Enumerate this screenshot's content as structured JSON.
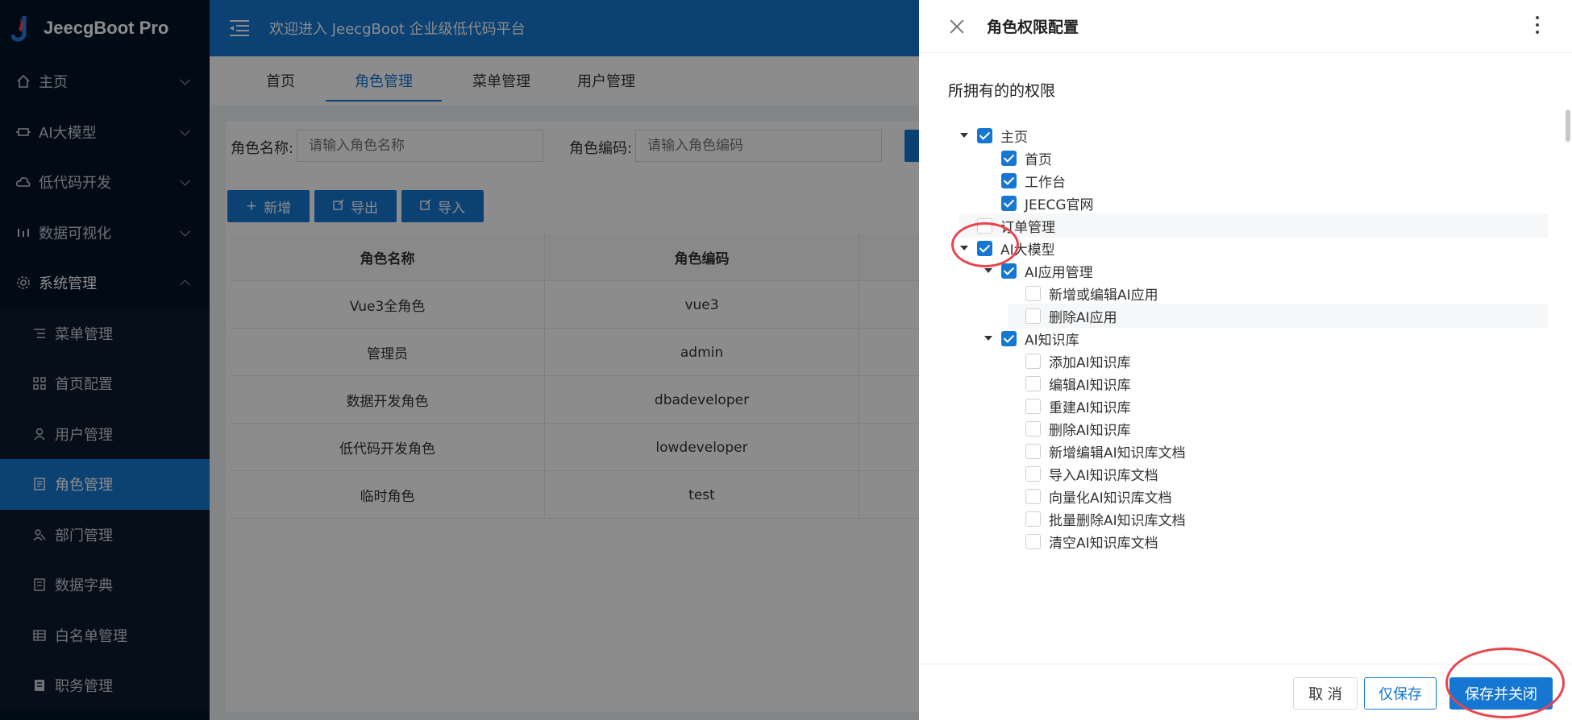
{
  "app": {
    "name": "JeecgBoot Pro"
  },
  "sidebar": {
    "items": [
      {
        "label": "主页",
        "icon": "home-icon"
      },
      {
        "label": "AI大模型",
        "icon": "ai-icon"
      },
      {
        "label": "低代码开发",
        "icon": "cloud-icon"
      },
      {
        "label": "数据可视化",
        "icon": "chart-icon"
      },
      {
        "label": "系统管理",
        "icon": "gear-icon"
      }
    ],
    "sub_items": [
      {
        "label": "菜单管理",
        "icon": "menu-icon"
      },
      {
        "label": "首页配置",
        "icon": "grid-icon"
      },
      {
        "label": "用户管理",
        "icon": "user-icon"
      },
      {
        "label": "角色管理",
        "icon": "role-icon"
      },
      {
        "label": "部门管理",
        "icon": "dept-icon"
      },
      {
        "label": "数据字典",
        "icon": "dict-icon"
      },
      {
        "label": "白名单管理",
        "icon": "table-icon"
      },
      {
        "label": "职务管理",
        "icon": "position-icon"
      }
    ]
  },
  "header": {
    "title": "欢迎进入 JeecgBoot 企业级低代码平台"
  },
  "tabs": [
    "首页",
    "角色管理",
    "菜单管理",
    "用户管理"
  ],
  "search": {
    "role_name_label": "角色名称:",
    "role_name_placeholder": "请输入角色名称",
    "role_code_label": "角色编码:",
    "role_code_placeholder": "请输入角色编码"
  },
  "toolbar": {
    "add": "新增",
    "export": "导出",
    "import": "导入"
  },
  "table": {
    "headers": [
      "角色名称",
      "角色编码"
    ],
    "rows": [
      [
        "Vue3全角色",
        "vue3"
      ],
      [
        "管理员",
        "admin"
      ],
      [
        "数据开发角色",
        "dbadeveloper"
      ],
      [
        "低代码开发角色",
        "lowdeveloper"
      ],
      [
        "临时角色",
        "test"
      ]
    ]
  },
  "drawer": {
    "title": "角色权限配置",
    "section_title": "所拥有的的权限",
    "tree": [
      {
        "label": "主页",
        "checked": true,
        "caret": true
      },
      {
        "label": "首页",
        "checked": true,
        "caret": false
      },
      {
        "label": "工作台",
        "checked": true,
        "caret": false
      },
      {
        "label": "JEECG官网",
        "checked": true,
        "caret": false
      },
      {
        "label": "订单管理",
        "checked": false,
        "caret": false
      },
      {
        "label": "AI大模型",
        "checked": true,
        "caret": true
      },
      {
        "label": "AI应用管理",
        "checked": true,
        "caret": true
      },
      {
        "label": "新增或编辑AI应用",
        "checked": false,
        "caret": false
      },
      {
        "label": "删除AI应用",
        "checked": false,
        "caret": false
      },
      {
        "label": "AI知识库",
        "checked": true,
        "caret": true
      },
      {
        "label": "添加AI知识库",
        "checked": false,
        "caret": false
      },
      {
        "label": "编辑AI知识库",
        "checked": false,
        "caret": false
      },
      {
        "label": "重建AI知识库",
        "checked": false,
        "caret": false
      },
      {
        "label": "删除AI知识库",
        "checked": false,
        "caret": false
      },
      {
        "label": "新增编辑AI知识库文档",
        "checked": false,
        "caret": false
      },
      {
        "label": "导入AI知识库文档",
        "checked": false,
        "caret": false
      },
      {
        "label": "向量化AI知识库文档",
        "checked": false,
        "caret": false
      },
      {
        "label": "批量删除AI知识库文档",
        "checked": false,
        "caret": false
      },
      {
        "label": "清空AI知识库文档",
        "checked": false,
        "caret": false
      }
    ],
    "footer": {
      "cancel": "取 消",
      "save": "仅保存",
      "save_close": "保存并关闭"
    }
  },
  "colors": {
    "primary": "#1677d2",
    "sidebar": "#001529",
    "annotation": "#e8454c"
  }
}
